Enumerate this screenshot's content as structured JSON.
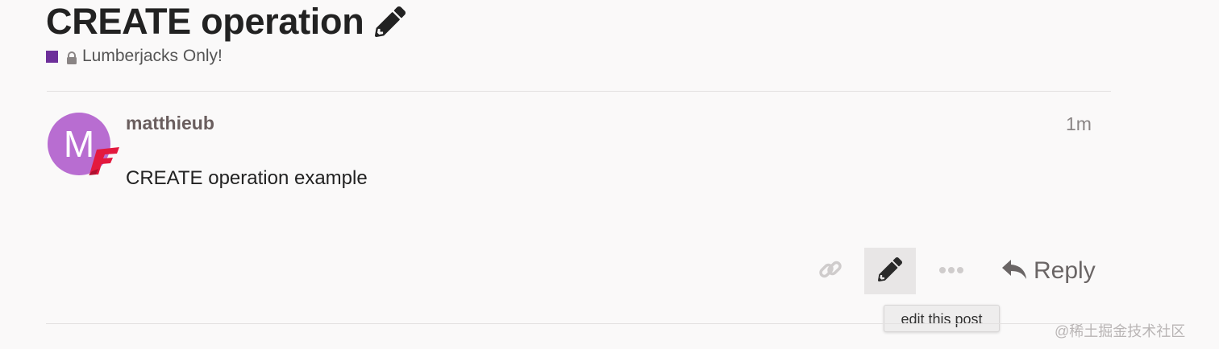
{
  "topic": {
    "title": "CREATE operation",
    "category": "Lumberjacks Only!",
    "category_color": "#6d2f9a"
  },
  "post": {
    "author": "matthieub",
    "avatar_letter": "M",
    "avatar_color": "#b86dd1",
    "time": "1m",
    "body": "CREATE operation example"
  },
  "actions": {
    "copy_link_icon": "link-icon",
    "edit_icon": "pencil-icon",
    "more_icon": "ellipsis-icon",
    "reply_label": "Reply",
    "reply_icon": "reply-arrow-icon"
  },
  "tooltip": {
    "text": "edit this post"
  },
  "watermark": {
    "text": "@稀土掘金技术社区"
  }
}
